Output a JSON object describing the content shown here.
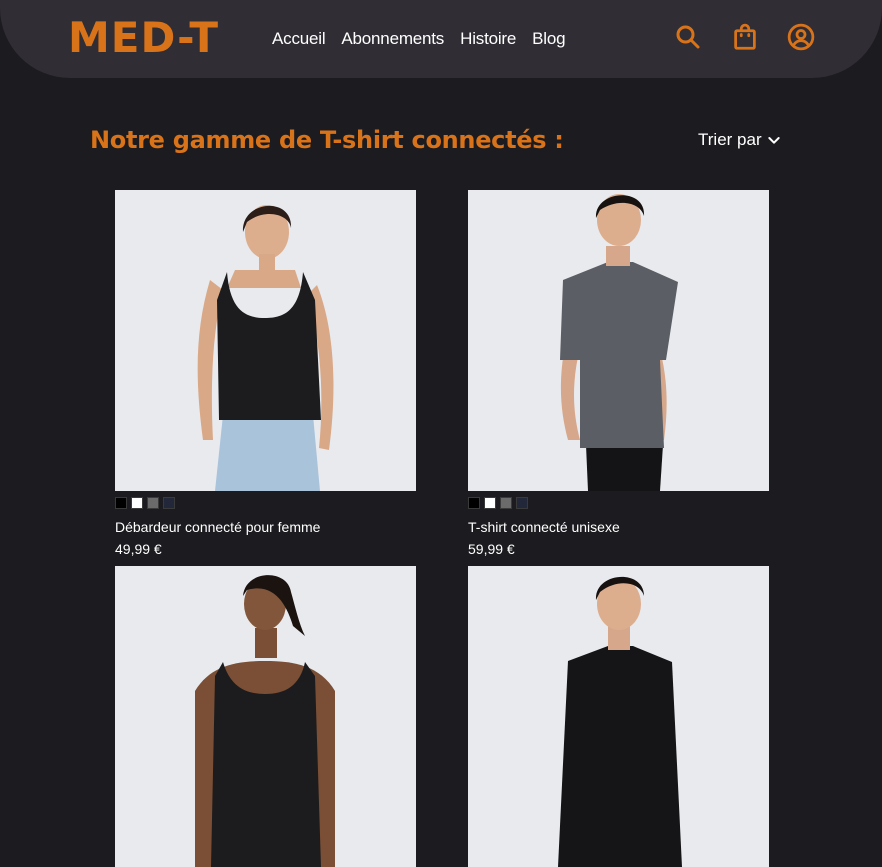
{
  "brand": {
    "logo_text": "MED-T",
    "accent_color": "#d9731a"
  },
  "nav": {
    "items": [
      {
        "label": "Accueil"
      },
      {
        "label": "Abonnements"
      },
      {
        "label": "Histoire"
      },
      {
        "label": "Blog"
      }
    ]
  },
  "header_icons": [
    "search-icon",
    "shopping-bag-icon",
    "user-account-icon"
  ],
  "catalog": {
    "title": "Notre gamme de T-shirt connectés :",
    "sort_label": "Trier par"
  },
  "products": [
    {
      "name": "Débardeur connecté pour femme",
      "price": "49,99 €",
      "garment_color": "#1c1c1e",
      "swatches": [
        "#000000",
        "#ffffff",
        "#6b6b6b",
        "#22283a"
      ]
    },
    {
      "name": "T-shirt connecté unisexe",
      "price": "59,99 €",
      "garment_color": "#5c5e66",
      "swatches": [
        "#000000",
        "#ffffff",
        "#6b6b6b",
        "#22283a"
      ]
    },
    {
      "name": "",
      "price": "",
      "garment_color": "#1c1c1e",
      "swatches": []
    },
    {
      "name": "",
      "price": "",
      "garment_color": "#151517",
      "swatches": []
    }
  ]
}
